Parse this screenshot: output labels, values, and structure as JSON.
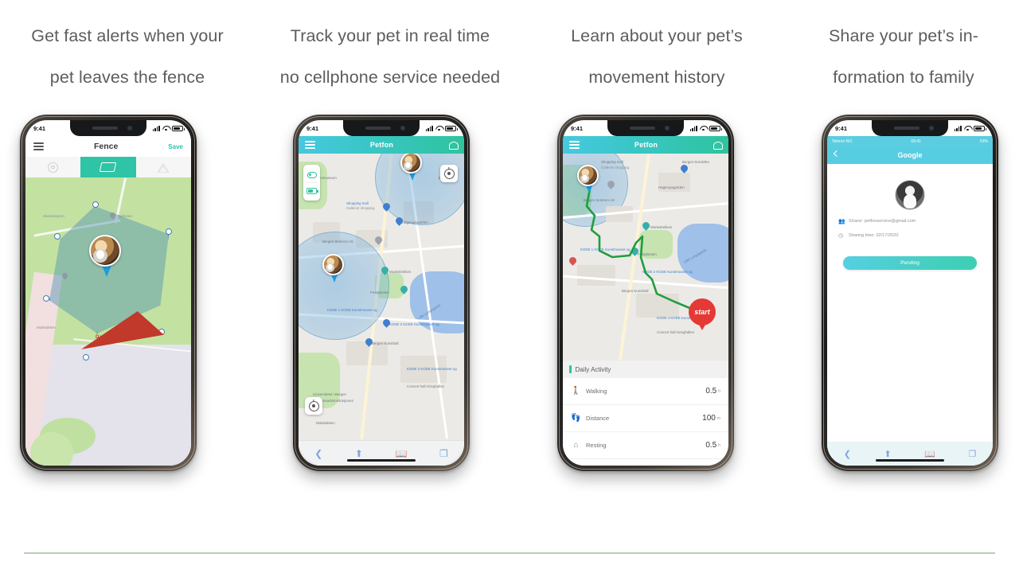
{
  "captions": [
    {
      "line1": "Get fast alerts when your",
      "line2": "pet  leaves  the   fence"
    },
    {
      "line1": "Track your pet in real time",
      "line2": "no cellphone service needed"
    },
    {
      "line1": "Learn  about   your  pet’s",
      "line2": "movement   history"
    },
    {
      "line1": "Share your pet’s in-",
      "line2": "formation to family"
    }
  ],
  "status_bar": {
    "time": "9:41"
  },
  "phone1": {
    "app_title": "Fence",
    "save_label": "Save",
    "menu_icon": "hamburger-menu-icon",
    "shape_tabs": [
      {
        "name": "circle",
        "active": false
      },
      {
        "name": "polygon",
        "active": true
      },
      {
        "name": "triangle",
        "active": false
      }
    ],
    "map": {
      "danger_label": "Danger",
      "poi_labels": [
        "Fjellveien",
        "Skansemyren",
        "Mulebakken"
      ]
    }
  },
  "phone2": {
    "app_title": "Petfon",
    "menu_icon": "hamburger-menu-icon",
    "bell_icon": "notification-bell-icon",
    "side_controls": [
      "tracking-mode-icon",
      "battery-icon"
    ],
    "locate_icon": "locate-compass-icon",
    "map_labels": [
      "Vitenmuseum",
      "Bergen",
      "Shopping mall",
      "Galleriet shopping",
      "Hagerupsgarden",
      "Bergen Sentrum AS",
      "Munkebekken",
      "Festplassen",
      "Lille Lungegards",
      "KODE 1 KODE Kunstmuseet og",
      "KODE 2 KODE Kunstmuseet og",
      "KODE 4 KODE Kunstmuseet og",
      "Bergen Kunsthall",
      "Concert hall Grieghallen",
      "Universitetet i Bergen",
      "Fakultetsadministrasjonen",
      "Mulebakken"
    ],
    "safari_icons": [
      "back-icon",
      "share-icon",
      "bookmarks-icon",
      "tabs-icon"
    ]
  },
  "phone3": {
    "app_title": "Petfon",
    "menu_icon": "hamburger-menu-icon",
    "bell_icon": "notification-bell-icon",
    "start_marker_label": "start",
    "activity_title": "Daily Activity",
    "activity_rows": [
      {
        "icon": "walking-icon",
        "label": "Walking",
        "value": "0.5",
        "unit": "h"
      },
      {
        "icon": "distance-icon",
        "label": "Distance",
        "value": "100",
        "unit": "m"
      },
      {
        "icon": "resting-icon",
        "label": "Resting",
        "value": "0.5",
        "unit": "h"
      }
    ],
    "map_labels": [
      "Vitenmuseum",
      "Bergen Domkirke",
      "Shopping mall",
      "Galleriet shopping",
      "Hagerupsgarden",
      "Bergen Sentrum AS",
      "Munkebekken",
      "Festplassen",
      "Lille Lungegards",
      "KODE 1 KODE Kunstmuseet og",
      "KODE 2 KODE Kunstmuseet og",
      "KODE 4 KODE Kunstmuseet og",
      "Bergen Kunsthall",
      "Concert hall Grieghallen"
    ]
  },
  "phone4": {
    "inner_status": {
      "carrier": "Telenor NO",
      "time": "09:41",
      "battery": "53%"
    },
    "app_title": "Google",
    "back_icon": "back-chevron-icon",
    "avatar_icon": "user-avatar",
    "sharer_label": "Sharer: petfonservice@gmail.com",
    "sharer_icon": "contact-icon",
    "time_label": "Sharing time: 02/17/2020",
    "time_icon": "clock-icon",
    "action_button": "Pending",
    "safari_icons": [
      "back-icon",
      "share-icon",
      "bookmarks-icon",
      "tabs-icon"
    ]
  },
  "colors": {
    "accent_teal": "#2ec4a5",
    "header_cyan": "#57cde2",
    "fence_blue": "#3f7fb8",
    "danger_red": "#c0392b",
    "route_green": "#1f9d3f",
    "start_red": "#e53935"
  }
}
